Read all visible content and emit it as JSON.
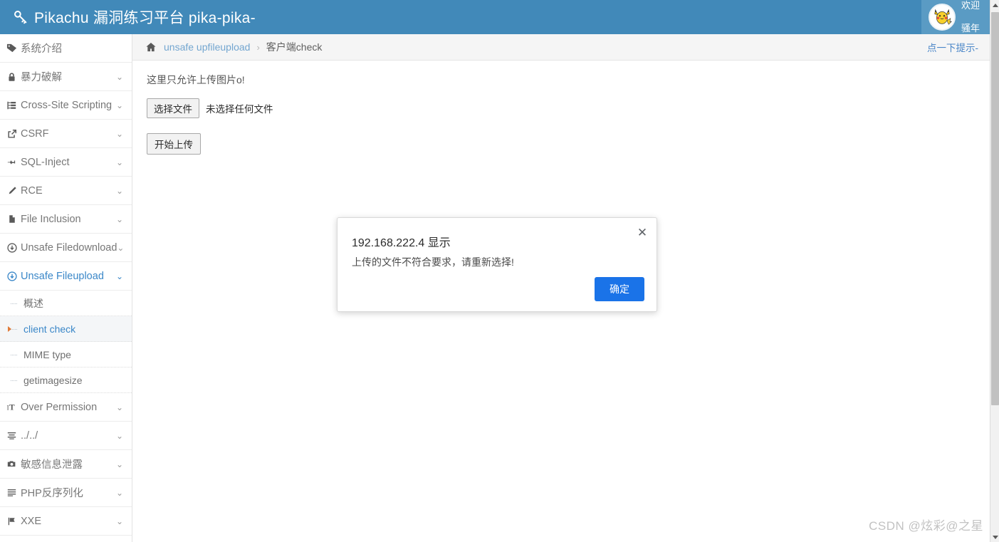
{
  "header": {
    "logo_icon": "key-icon",
    "title": "Pikachu 漏洞练习平台 pika-pika-",
    "avatar_icon": "pikachu-avatar",
    "welcome_line1": "欢迎",
    "welcome_line2": "骚年",
    "bg_color": "#4189b9"
  },
  "sidebar": {
    "items": [
      {
        "icon": "tag-icon",
        "label": "系统介绍",
        "caret": false,
        "open": false
      },
      {
        "icon": "lock-icon",
        "label": "暴力破解",
        "caret": true,
        "open": false
      },
      {
        "icon": "sitemap-icon",
        "label": "Cross-Site Scripting",
        "caret": true,
        "open": false
      },
      {
        "icon": "external-link-icon",
        "label": "CSRF",
        "caret": true,
        "open": false
      },
      {
        "icon": "plane-icon",
        "label": "SQL-Inject",
        "caret": true,
        "open": false
      },
      {
        "icon": "pencil-icon",
        "label": "RCE",
        "caret": true,
        "open": false
      },
      {
        "icon": "file-icon",
        "label": "File Inclusion",
        "caret": true,
        "open": false
      },
      {
        "icon": "download-circle-icon",
        "label": "Unsafe Filedownload",
        "caret": true,
        "open": false
      },
      {
        "icon": "upload-circle-icon",
        "label": "Unsafe Fileupload",
        "caret": true,
        "open": true
      }
    ],
    "submenu": [
      {
        "label": "概述",
        "active": false
      },
      {
        "label": "client check",
        "active": true
      },
      {
        "label": "MIME type",
        "active": false
      },
      {
        "label": "getimagesize",
        "active": false
      }
    ],
    "items_after": [
      {
        "icon": "text-height-icon",
        "label": "Over Permission",
        "caret": true,
        "open": false
      },
      {
        "icon": "list-icon",
        "label": "../../",
        "caret": true,
        "open": false
      },
      {
        "icon": "camera-icon",
        "label": "敏感信息泄露",
        "caret": true,
        "open": false
      },
      {
        "icon": "align-icon",
        "label": "PHP反序列化",
        "caret": true,
        "open": false
      },
      {
        "icon": "flag-icon",
        "label": "XXE",
        "caret": true,
        "open": false
      }
    ],
    "active_accent": "#3a87c8",
    "bullet_color": "#e07b39"
  },
  "breadcrumb": {
    "home_icon": "home-icon",
    "link": "unsafe upfileupload",
    "separator": "›",
    "current": "客户端check",
    "hint_link": "点一下提示-"
  },
  "main": {
    "notice": "这里只允许上传图片o!",
    "choose_file_button": "选择文件",
    "file_status": "未选择任何文件",
    "upload_button": "开始上传"
  },
  "modal": {
    "title": "192.168.222.4 显示",
    "message": "上传的文件不符合要求，请重新选择!",
    "ok_button": "确定",
    "close_icon": "close-icon",
    "ok_color": "#1a73e8"
  },
  "scrollbar": {
    "up_icon": "chevron-up-icon",
    "down_icon": "chevron-down-icon"
  },
  "watermark": "CSDN @炫彩@之星"
}
